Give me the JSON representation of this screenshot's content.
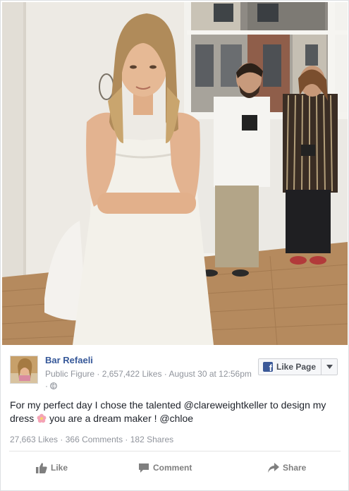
{
  "post": {
    "page_name": "Bar Refaeli",
    "category": "Public Figure",
    "likes": "2,657,422 Likes",
    "date": "August 30 at 12:56pm",
    "text_part1": "For my perfect day I chose the talented @clareweightkeller to design my dress",
    "text_part2": "you are a dream maker ! @chloe",
    "stats": "27,663 Likes · 366 Comments · 182 Shares"
  },
  "like_page_button": {
    "label": "Like Page"
  },
  "actions": {
    "like": "Like",
    "comment": "Comment",
    "share": "Share"
  },
  "icons": {
    "avatar": "profile-photo",
    "facebook": "facebook-f-icon",
    "caret": "chevron-down-icon",
    "globe": "globe-icon",
    "emoji": "flower-emoji-icon",
    "like": "thumbs-up-icon",
    "comment": "comment-bubble-icon",
    "share": "share-arrow-icon"
  },
  "colors": {
    "link": "#365899",
    "meta": "#90949c",
    "fb_blue": "#3b5998",
    "action": "#7f7f7f"
  }
}
